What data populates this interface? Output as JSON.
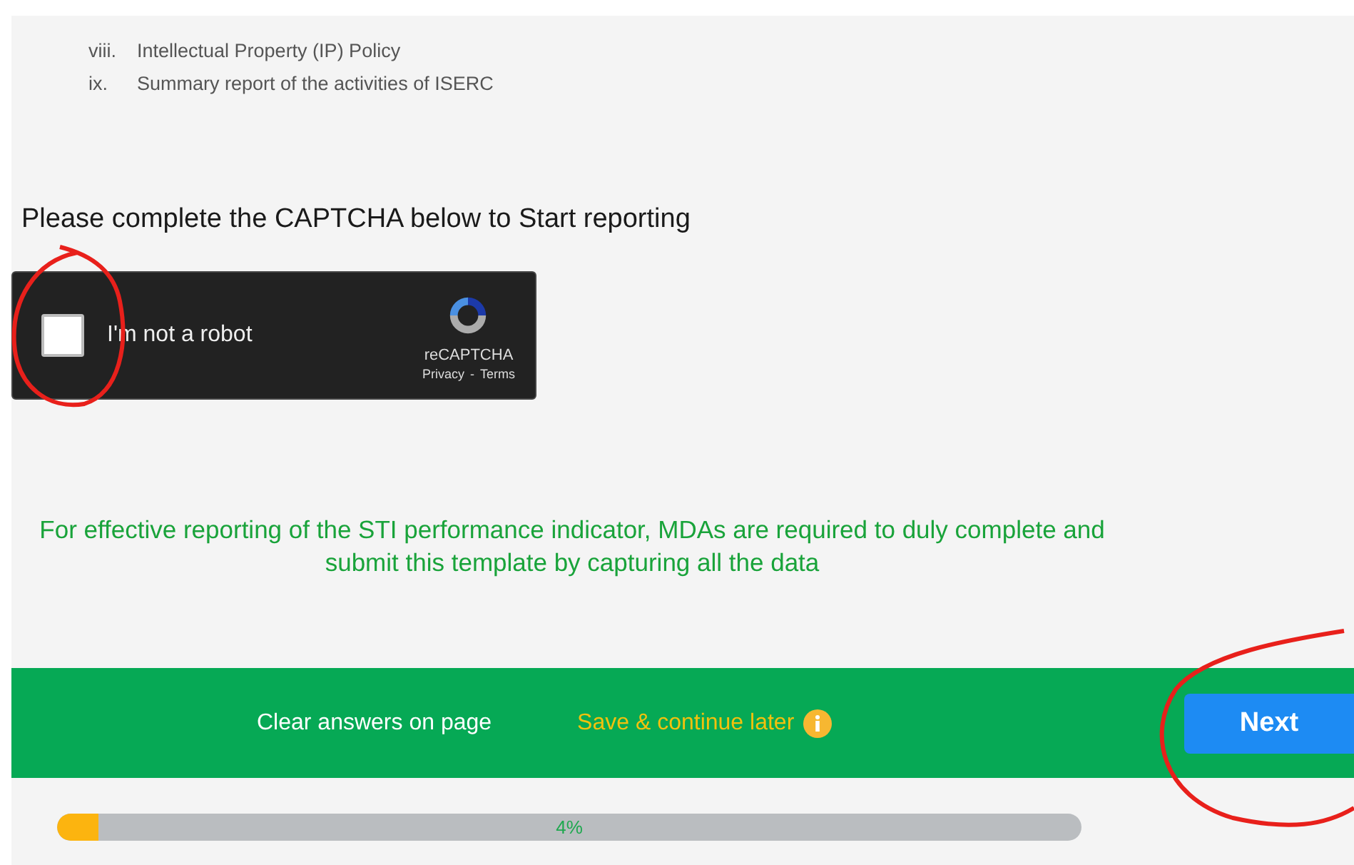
{
  "document_list": [
    {
      "number": "viii.",
      "text": "Intellectual Property (IP) Policy"
    },
    {
      "number": "ix.",
      "text": "Summary report of the activities of ISERC"
    }
  ],
  "captcha_prompt": "Please complete the CAPTCHA below to Start reporting",
  "captcha": {
    "label": "I'm not a robot",
    "checked": false,
    "brand": "reCAPTCHA",
    "privacy_link": "Privacy",
    "separator": "-",
    "terms_link": "Terms"
  },
  "notice": "For effective reporting of the STI performance indicator, MDAs are required to duly complete and submit this template by capturing all the data",
  "action_bar": {
    "clear_link": "Clear answers on page",
    "save_link": "Save & continue later",
    "next_button": "Next"
  },
  "progress": {
    "level": 0.04,
    "reading": "4%"
  }
}
